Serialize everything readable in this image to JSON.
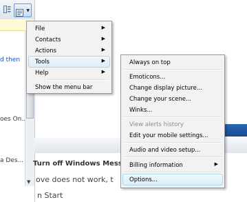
{
  "background": {
    "fragments": [
      {
        "text": "d then",
        "kind": "link"
      },
      {
        "text": "oes On...",
        "kind": "text"
      },
      {
        "text": "a Des...",
        "kind": "text"
      }
    ],
    "heading": "Turn off Windows Mess",
    "line1": "ove does not work, t",
    "line2": "n Start"
  },
  "main_menu": {
    "items": [
      {
        "label": "File",
        "submenu": true
      },
      {
        "label": "Contacts",
        "submenu": true
      },
      {
        "label": "Actions",
        "submenu": true
      },
      {
        "label": "Tools",
        "submenu": true,
        "active": true
      },
      {
        "label": "Help",
        "submenu": true
      },
      {
        "label": "Show the menu bar",
        "submenu": false
      }
    ]
  },
  "tools_menu": {
    "items": [
      {
        "label": "Always on top"
      },
      {
        "label": "Emoticons..."
      },
      {
        "label": "Change display picture..."
      },
      {
        "label": "Change your scene..."
      },
      {
        "label": "Winks..."
      },
      {
        "label": "View alerts history",
        "disabled": true
      },
      {
        "label": "Edit your mobile settings..."
      },
      {
        "label": "Audio and video setup..."
      },
      {
        "label": "Billing information",
        "submenu": true
      },
      {
        "label": "Options...",
        "active": true
      }
    ]
  },
  "colors": {
    "menu_bg": "#f2f2f2",
    "highlight_border": "#a8d8eb",
    "link": "#1a53c4",
    "toolbar_accent": "#6c9ad3"
  },
  "icons": {
    "chevron": "chevron-right-icon",
    "toolbar_left": "contacts-view-icon",
    "toolbar_menu": "show-menu-icon"
  }
}
